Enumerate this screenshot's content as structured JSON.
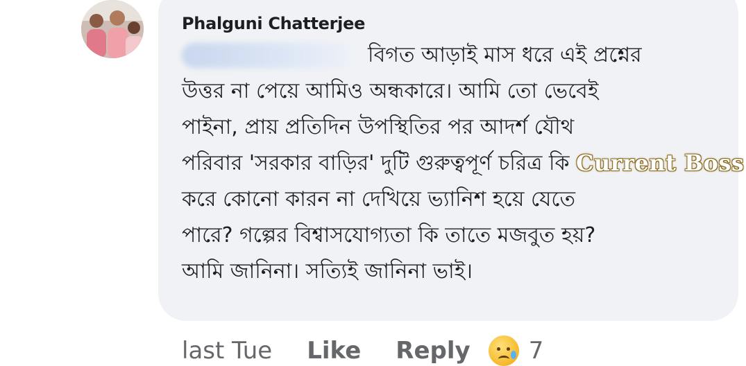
{
  "comment": {
    "author": "Phalguni Chatterjee",
    "lines": [
      "বিগত আড়াই মাস ধরে এই প্রশ্নের",
      "উত্তর না পেয়ে আমিও অন্ধকারে। আমি তো ভেবেই",
      "পাইনা, প্রায় প্রতিদিন উপস্থিতির পর আদর্শ যৌথ",
      "পরিবার 'সরকার বাড়ির' দুটি গুরুত্বপূর্ণ চরিত্র কি",
      "করে কোনো কারন না দেখিয়ে ভ্যানিশ হয়ে যেতে",
      "পারে? গল্পের বিশ্বাসযোগ্যতা কি তাতে মজবুত হয়?",
      "আমি জানিনা। সত্যিই জানিনা ভাই।"
    ]
  },
  "watermark": "Current Boss",
  "actions": {
    "time": "last Tue",
    "like": "Like",
    "reply": "Reply",
    "reaction_icon": "sad-tear-emoji-icon",
    "reaction_count": "7"
  }
}
